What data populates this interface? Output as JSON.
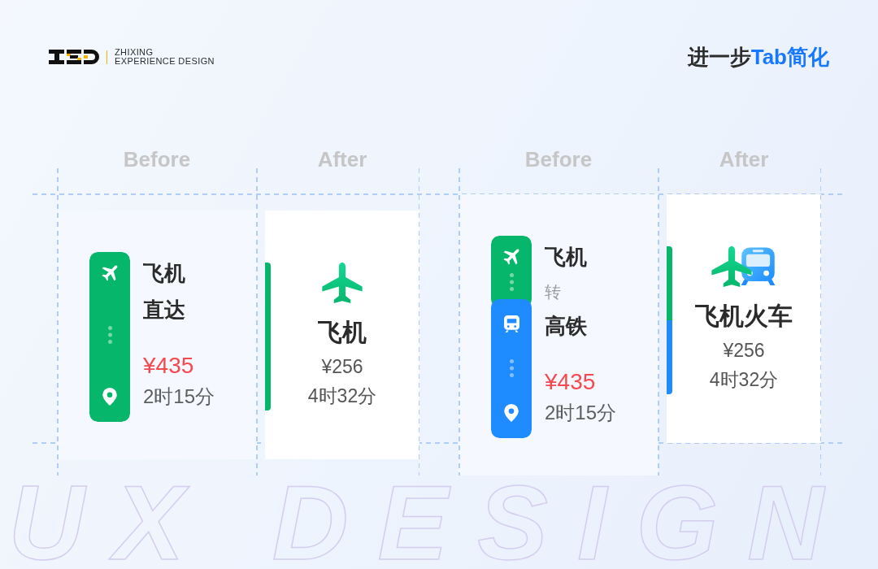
{
  "brand": {
    "name": "ZHIXING",
    "tagline": "EXPERIENCE DESIGN"
  },
  "heading": {
    "text": "进一步",
    "highlight": "Tab简化"
  },
  "comparisons": [
    {
      "before": {
        "label": "Before",
        "segments": [
          {
            "kind": "plane",
            "color": "#06b66b"
          }
        ],
        "lines": [
          {
            "kind": "title",
            "text": "飞机"
          },
          {
            "kind": "title",
            "text": "直达"
          },
          {
            "kind": "price",
            "text": "¥435"
          },
          {
            "kind": "duration",
            "text": "2时15分"
          }
        ]
      },
      "after": {
        "label": "After",
        "segments": [
          {
            "kind": "plane",
            "color": "#06b66b"
          }
        ],
        "title": "飞机",
        "price": "¥256",
        "duration": "4时32分"
      }
    },
    {
      "before": {
        "label": "Before",
        "segments": [
          {
            "kind": "plane",
            "color": "#06b66b"
          },
          {
            "kind": "train",
            "color": "#1e8cff"
          }
        ],
        "lines": [
          {
            "kind": "title",
            "text": "飞机"
          },
          {
            "kind": "note",
            "text": "转"
          },
          {
            "kind": "title",
            "text": "高铁"
          },
          {
            "kind": "price",
            "text": "¥435"
          },
          {
            "kind": "duration",
            "text": "2时15分"
          }
        ]
      },
      "after": {
        "label": "After",
        "segments": [
          {
            "kind": "plane",
            "color": "#06b66b"
          },
          {
            "kind": "train",
            "color": "#1e8cff"
          }
        ],
        "title": "飞机火车",
        "price": "¥256",
        "duration": "4时32分"
      }
    }
  ],
  "background_text": "UX DESIGN"
}
